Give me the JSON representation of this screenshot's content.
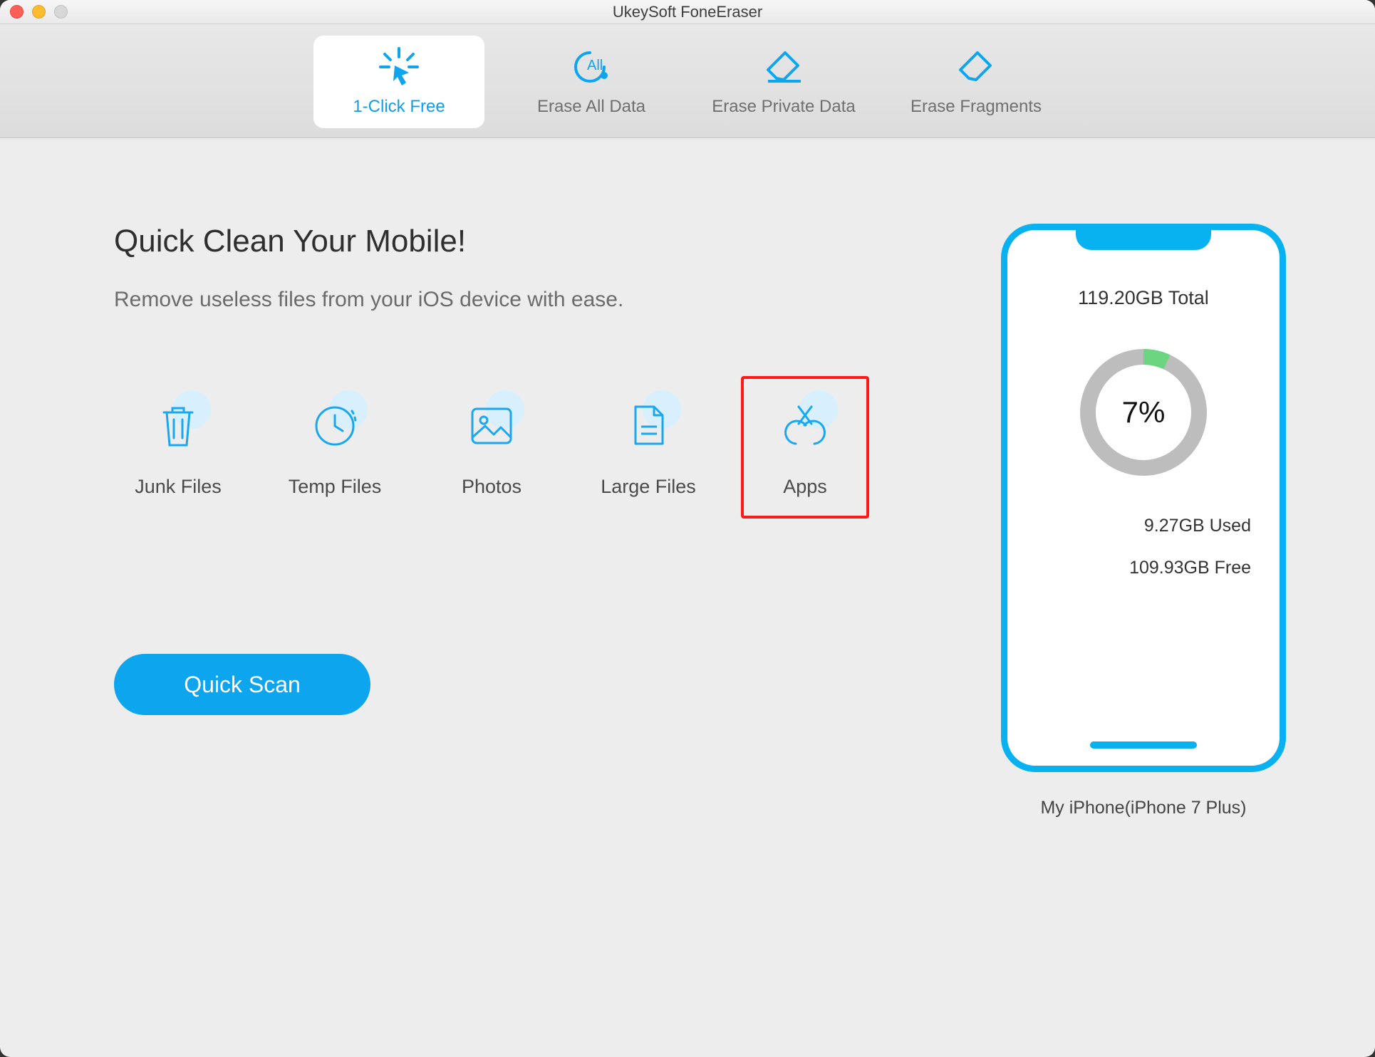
{
  "window": {
    "title": "UkeySoft FoneEraser"
  },
  "tabs": [
    {
      "label": "1-Click Free",
      "active": true
    },
    {
      "label": "Erase All Data",
      "active": false
    },
    {
      "label": "Erase Private Data",
      "active": false
    },
    {
      "label": "Erase Fragments",
      "active": false
    }
  ],
  "main": {
    "headline": "Quick Clean Your Mobile!",
    "subhead": "Remove useless files from your iOS device with ease.",
    "categories": [
      {
        "label": "Junk Files",
        "highlight": false
      },
      {
        "label": "Temp Files",
        "highlight": false
      },
      {
        "label": "Photos",
        "highlight": false
      },
      {
        "label": "Large Files",
        "highlight": false
      },
      {
        "label": "Apps",
        "highlight": true
      }
    ],
    "scan_button": "Quick Scan"
  },
  "device": {
    "total": "119.20GB Total",
    "percent_label": "7%",
    "percent_value": 7,
    "used": "9.27GB Used",
    "free": "109.93GB Free",
    "name": "My iPhone(iPhone 7 Plus)"
  },
  "colors": {
    "accent": "#0ea5ef",
    "highlight": "#ff1a1a"
  }
}
